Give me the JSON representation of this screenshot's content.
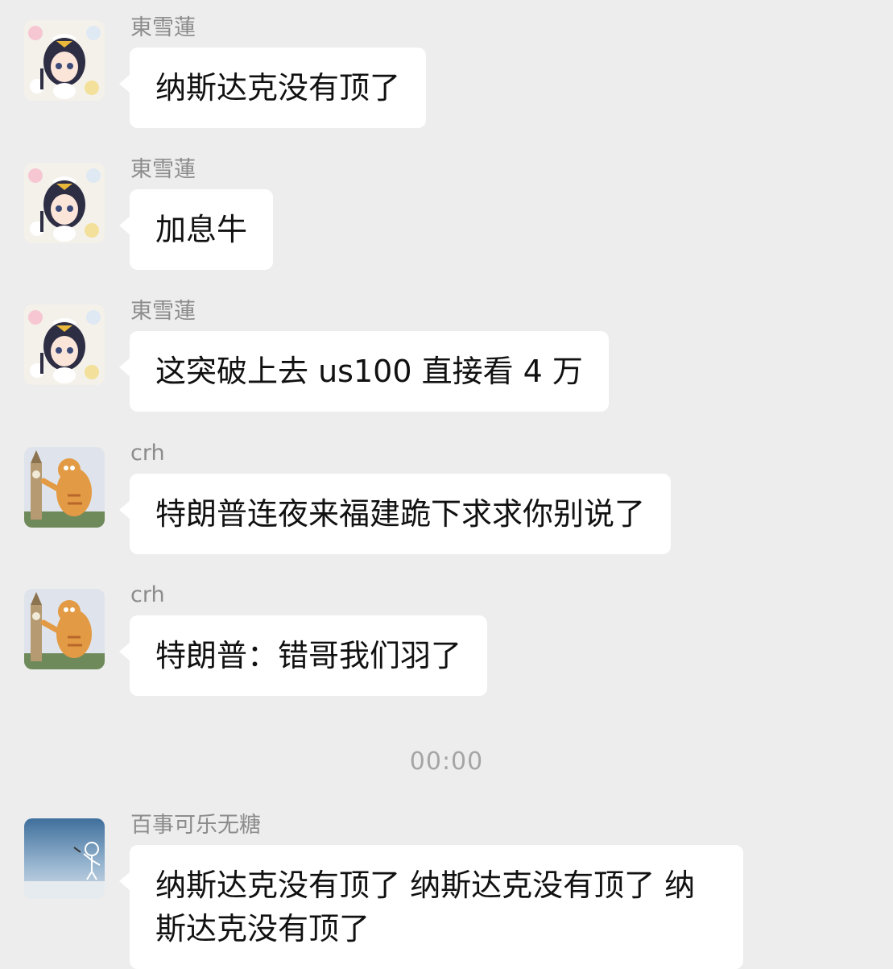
{
  "messages": [
    {
      "sender": "東雪蓮",
      "text": "纳斯达克没有顶了",
      "avatar": "anime-girl-avatar"
    },
    {
      "sender": "東雪蓮",
      "text": "加息牛",
      "avatar": "anime-girl-avatar"
    },
    {
      "sender": "東雪蓮",
      "text": "这突破上去 us100 直接看 4 万",
      "avatar": "anime-girl-avatar"
    },
    {
      "sender": "crh",
      "text": "特朗普连夜来福建跪下求求你别说了",
      "avatar": "garfield-big-ben-avatar"
    },
    {
      "sender": "crh",
      "text": "特朗普：错哥我们羽了",
      "avatar": "garfield-big-ben-avatar"
    },
    {
      "sender": "百事可乐无糖",
      "text": "纳斯达克没有顶了 纳斯达克没有顶了 纳斯达克没有顶了",
      "avatar": "sky-sketch-avatar"
    }
  ],
  "timestamp": "00:00",
  "colors": {
    "background": "#ededed",
    "bubble": "#ffffff",
    "sender_name": "#8c8c8c",
    "timestamp": "#a5a5a5"
  }
}
